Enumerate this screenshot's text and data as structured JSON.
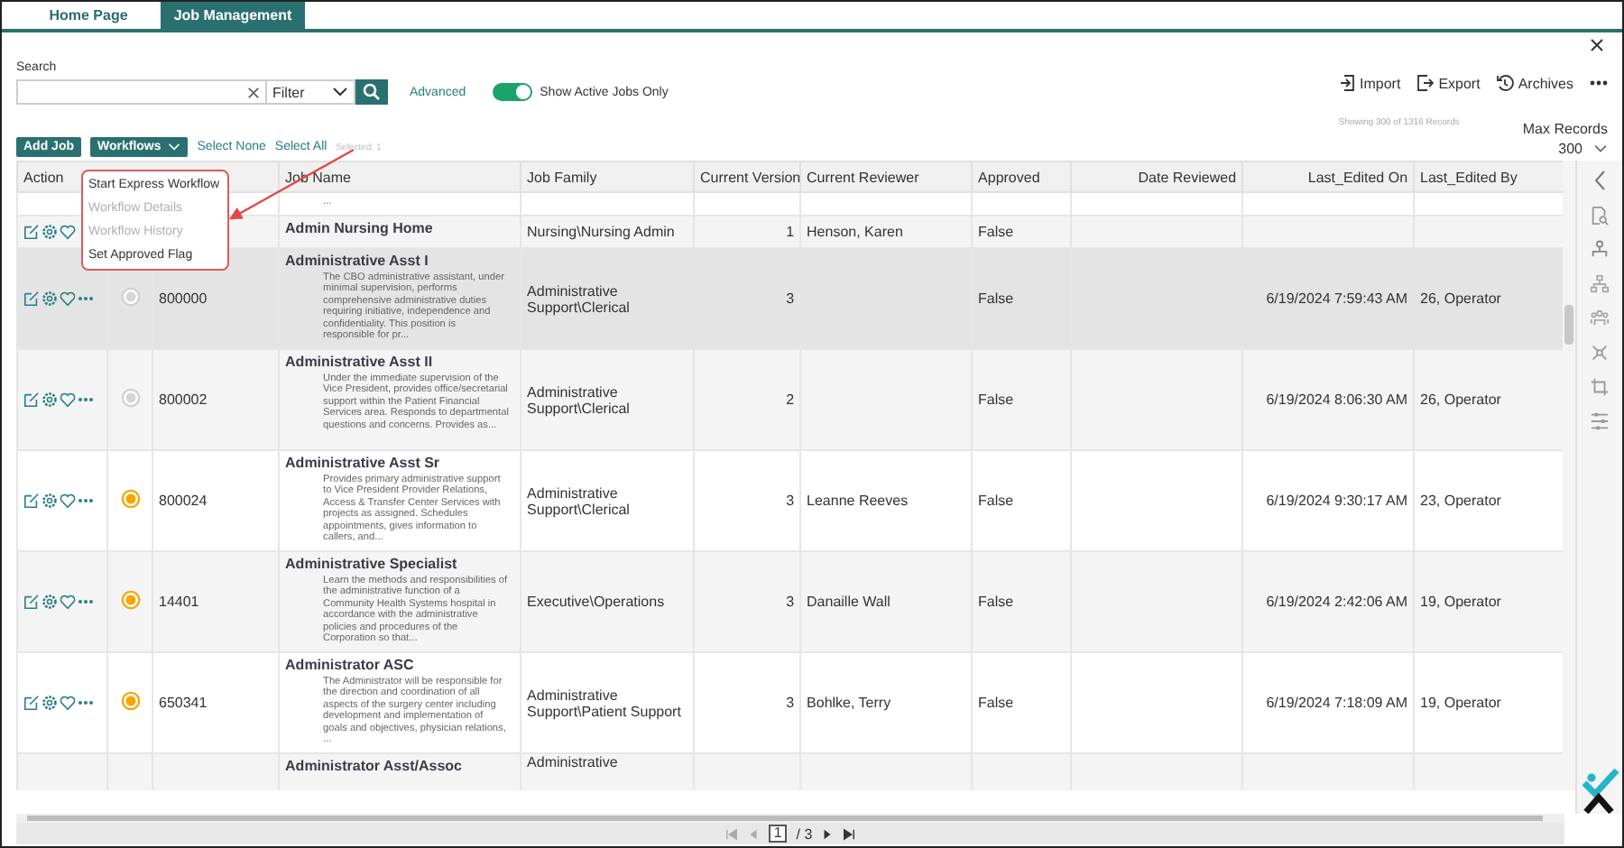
{
  "tabs": [
    {
      "label": "Home Page",
      "selected": false
    },
    {
      "label": "Job Management",
      "selected": true
    }
  ],
  "search": {
    "label": "Search",
    "filter": "Filter",
    "advanced": "Advanced",
    "toggle": {
      "label": "Show Active Jobs Only",
      "on": true
    }
  },
  "actions": [
    {
      "kind": "import",
      "label": "Import"
    },
    {
      "kind": "export",
      "label": "Export"
    },
    {
      "kind": "archives",
      "label": "Archives"
    }
  ],
  "toolbar": {
    "add": "Add Job",
    "workflows": "Workflows",
    "select_none": "Select None",
    "select_all": "Select All",
    "selected_count": "Selected: 1"
  },
  "records": {
    "showing": "Showing 300 of 1316 Records",
    "max_label": "Max Records",
    "max_value": "300"
  },
  "workflow_menu": [
    {
      "label": "Start Express Workflow",
      "disabled": false
    },
    {
      "label": "Workflow Details",
      "disabled": true
    },
    {
      "label": "Workflow History",
      "disabled": true
    },
    {
      "label": "Set Approved Flag",
      "disabled": false
    }
  ],
  "table": {
    "columns": [
      "Action",
      "Job Name",
      "Job Family",
      "Current Version",
      "Current Reviewer",
      "Approved",
      "Date Reviewed",
      "Last_Edited On",
      "Last_Edited By"
    ],
    "rows": [
      {
        "kind": "cut",
        "description": "...",
        "selected": false
      },
      {
        "kind": "full",
        "job_name": "Admin Nursing Home",
        "job_family": "Nursing\\Nursing Admin",
        "current_version": "1",
        "current_reviewer": "Henson, Karen",
        "approved": "False",
        "selected": false
      },
      {
        "kind": "full",
        "active": false,
        "code": "800000",
        "job_name": "Administrative Asst I",
        "description": "The CBO administrative assistant, under minimal supervision, performs comprehensive administrative duties requiring initiative, independence and confidentiality. This position is responsible for pr...",
        "job_family": "Administrative Support\\Clerical",
        "current_version": "3",
        "approved": "False",
        "last_edited_on": "6/19/2024 7:59:43 AM",
        "last_edited_by": "26, Operator",
        "selected": true
      },
      {
        "kind": "full",
        "active": false,
        "code": "800002",
        "job_name": "Administrative Asst II",
        "description": "Under the immediate supervision of the Vice President, provides office/secretarial support within the Patient Financial Services area.  Responds to departmental questions and concerns.  Provides as...",
        "job_family": "Administrative Support\\Clerical",
        "current_version": "2",
        "approved": "False",
        "last_edited_on": "6/19/2024 8:06:30 AM",
        "last_edited_by": "26, Operator",
        "selected": false
      },
      {
        "kind": "full",
        "active": true,
        "code": "800024",
        "job_name": "Administrative Asst Sr",
        "description": "Provides primary administrative support to Vice President Provider Relations, Access & Transfer Center Services with projects as assigned.  Schedules appointments, gives information to callers, and...",
        "job_family": "Administrative Support\\Clerical",
        "current_version": "3",
        "current_reviewer": "Leanne Reeves",
        "approved": "False",
        "last_edited_on": "6/19/2024 9:30:17 AM",
        "last_edited_by": "23, Operator",
        "selected": false
      },
      {
        "kind": "full",
        "active": true,
        "code": "14401",
        "job_name": "Administrative Specialist",
        "description": "Learn the methods and responsibilities of the administrative function of a Community Health Systems hospital in accordance with the administrative policies and procedures of the Corporation so that...",
        "job_family": "Executive\\Operations",
        "current_version": "3",
        "current_reviewer": "Danaille Wall",
        "approved": "False",
        "last_edited_on": "6/19/2024 2:42:06 AM",
        "last_edited_by": "19, Operator",
        "selected": false
      },
      {
        "kind": "full",
        "active": true,
        "code": "650341",
        "job_name": "Administrator ASC",
        "description": "The Administrator will be responsible for the direction and coordination of all aspects of the surgery center including development and implementation of goals and objectives, physician relations, ...",
        "job_family": "Administrative Support\\Patient Support",
        "current_version": "3",
        "current_reviewer": "Bohlke, Terry",
        "approved": "False",
        "last_edited_on": "6/19/2024 7:18:09 AM",
        "last_edited_by": "19, Operator",
        "selected": false
      },
      {
        "kind": "cut",
        "job_name": "Administrator Asst/Assoc",
        "job_family": "Administrative",
        "selected": false
      }
    ]
  },
  "pager": {
    "page": "1",
    "total": "/ 3"
  }
}
